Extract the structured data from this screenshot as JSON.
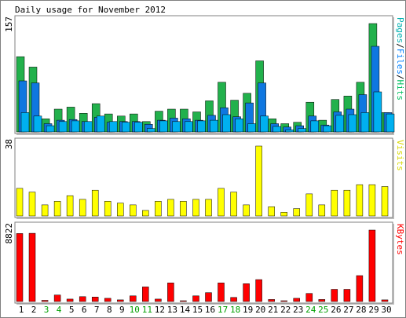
{
  "chart_data": {
    "type": "bar",
    "title": "Daily usage for November 2012",
    "days": [
      {
        "label": "1",
        "weekend": false
      },
      {
        "label": "2",
        "weekend": false
      },
      {
        "label": "3",
        "weekend": true
      },
      {
        "label": "4",
        "weekend": true
      },
      {
        "label": "5",
        "weekend": false
      },
      {
        "label": "6",
        "weekend": false
      },
      {
        "label": "7",
        "weekend": false
      },
      {
        "label": "8",
        "weekend": false
      },
      {
        "label": "9",
        "weekend": false
      },
      {
        "label": "10",
        "weekend": true
      },
      {
        "label": "11",
        "weekend": true
      },
      {
        "label": "12",
        "weekend": false
      },
      {
        "label": "13",
        "weekend": false
      },
      {
        "label": "14",
        "weekend": false
      },
      {
        "label": "15",
        "weekend": false
      },
      {
        "label": "16",
        "weekend": false
      },
      {
        "label": "17",
        "weekend": true
      },
      {
        "label": "18",
        "weekend": true
      },
      {
        "label": "19",
        "weekend": false
      },
      {
        "label": "20",
        "weekend": false
      },
      {
        "label": "21",
        "weekend": false
      },
      {
        "label": "22",
        "weekend": false
      },
      {
        "label": "23",
        "weekend": false
      },
      {
        "label": "24",
        "weekend": true
      },
      {
        "label": "25",
        "weekend": true
      },
      {
        "label": "26",
        "weekend": false
      },
      {
        "label": "27",
        "weekend": false
      },
      {
        "label": "28",
        "weekend": false
      },
      {
        "label": "29",
        "weekend": false
      },
      {
        "label": "30",
        "weekend": false
      }
    ],
    "panels": [
      {
        "id": "hits",
        "max_label": "157",
        "ymax": 157,
        "legend": [
          {
            "text": "Pages",
            "color": "#00b0b0"
          },
          {
            "text": "/",
            "color": "#000000"
          },
          {
            "text": "Files",
            "color": "#0080ff"
          },
          {
            "text": "/",
            "color": "#000000"
          },
          {
            "text": "Hits",
            "color": "#00c060"
          }
        ],
        "series": [
          {
            "name": "Hits",
            "color": "#22b14c",
            "values": [
              109,
              94,
              19,
              33,
              36,
              27,
              41,
              26,
              23,
              26,
              15,
              30,
              33,
              33,
              29,
              45,
              72,
              46,
              56,
              103,
              19,
              12,
              14,
              43,
              17,
              47,
              52,
              72,
              157,
              28
            ]
          },
          {
            "name": "Files",
            "color": "#0f77e0",
            "values": [
              74,
              71,
              12,
              17,
              18,
              15,
              21,
              14,
              15,
              15,
              11,
              17,
              20,
              19,
              17,
              24,
              35,
              22,
              42,
              71,
              12,
              7,
              9,
              23,
              10,
              29,
              33,
              54,
              124,
              28
            ]
          },
          {
            "name": "Pages",
            "color": "#00b0f0",
            "values": [
              28,
              23,
              9,
              15,
              16,
              15,
              23,
              15,
              14,
              14,
              5,
              16,
              15,
              15,
              16,
              17,
              25,
              19,
              12,
              23,
              8,
              3,
              5,
              16,
              9,
              24,
              25,
              28,
              58,
              26
            ]
          }
        ]
      },
      {
        "id": "visits",
        "max_label": "38",
        "ymax": 38,
        "legend": [
          {
            "text": "Visits",
            "color": "#d8d800"
          }
        ],
        "series": [
          {
            "name": "Visits",
            "color": "#ffff00",
            "values": [
              15,
              13,
              6,
              8,
              11,
              9,
              14,
              8,
              7,
              6,
              3,
              8,
              9,
              8,
              9,
              9,
              15,
              13,
              6,
              38,
              5,
              2,
              4,
              12,
              6,
              14,
              14,
              17,
              17,
              16
            ]
          }
        ]
      },
      {
        "id": "kbytes",
        "max_label": "8822",
        "ymax": 8822,
        "legend": [
          {
            "text": "KBytes",
            "color": "#ff0000"
          }
        ],
        "series": [
          {
            "name": "KBytes",
            "color": "#ff0000",
            "values": [
              8400,
              8422,
              150,
              800,
              300,
              600,
              550,
              400,
              200,
              700,
              1800,
              300,
              2300,
              100,
              700,
              1100,
              2300,
              500,
              2200,
              2700,
              250,
              100,
              400,
              1000,
              250,
              1500,
              1500,
              3200,
              8822,
              200
            ]
          }
        ]
      }
    ]
  }
}
